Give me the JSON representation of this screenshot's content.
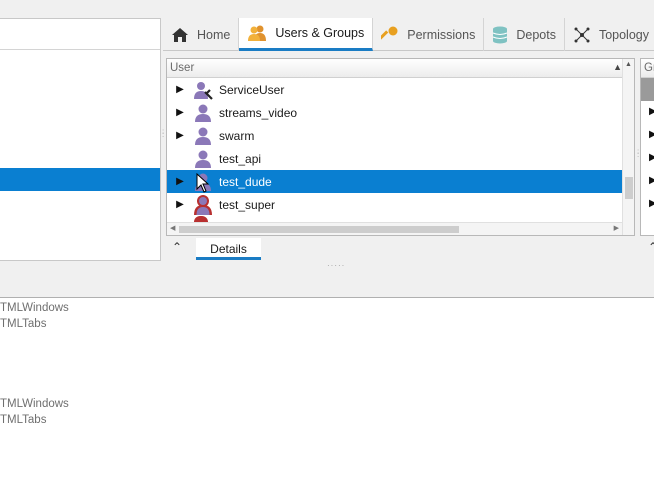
{
  "tabs": [
    {
      "label": "Home",
      "icon": "home-icon"
    },
    {
      "label": "Users & Groups",
      "icon": "users-icon",
      "active": true
    },
    {
      "label": "Permissions",
      "icon": "key-icon"
    },
    {
      "label": "Depots",
      "icon": "database-icon"
    },
    {
      "label": "Topology",
      "icon": "topology-icon"
    }
  ],
  "users_grid": {
    "column_header": "User",
    "rows": [
      {
        "name": "ServiceUser",
        "expandable": true,
        "icon": "service-user-icon"
      },
      {
        "name": "streams_video",
        "expandable": true,
        "icon": "user-icon"
      },
      {
        "name": "swarm",
        "expandable": true,
        "icon": "user-icon"
      },
      {
        "name": "test_api",
        "expandable": false,
        "icon": "user-icon"
      },
      {
        "name": "test_dude",
        "expandable": true,
        "icon": "user-icon",
        "selected": true
      },
      {
        "name": "test_super",
        "expandable": true,
        "icon": "super-user-icon"
      }
    ]
  },
  "groups_grid": {
    "column_header": "Gr"
  },
  "details_tab": {
    "label": "Details"
  },
  "output_lines": [
    "TMLWindows",
    "TMLTabs",
    "TMLWindows",
    "TMLTabs"
  ],
  "colors": {
    "selection": "#0a7fd1",
    "accent": "#1a7cc4",
    "user_icon": "#8b78b8",
    "super_user_icon": "#b83030"
  }
}
